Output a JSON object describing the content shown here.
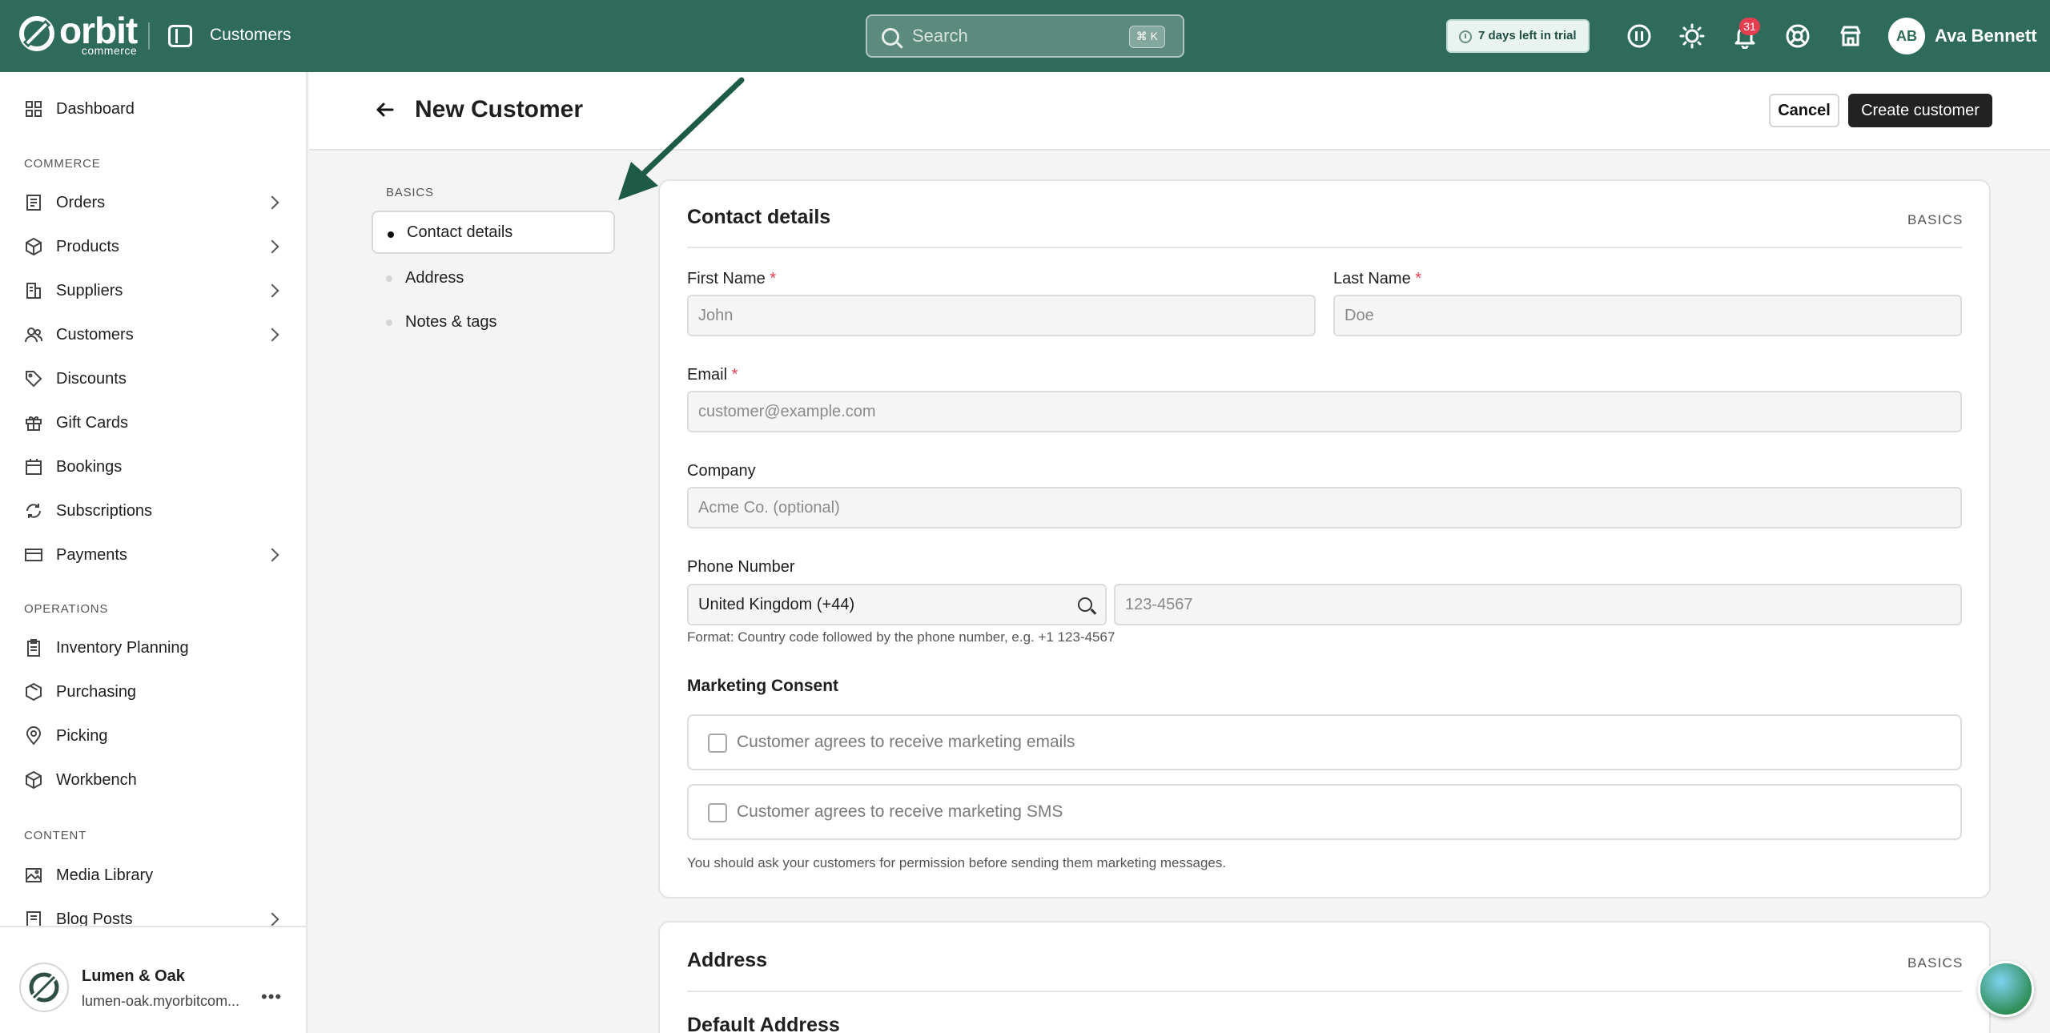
{
  "app": {
    "brand": "orbit",
    "brand_sub": "commerce",
    "header_title": "Customers",
    "accent_color": "#2f6b5a"
  },
  "search": {
    "placeholder": "Search",
    "shortcut": "⌘ K"
  },
  "trial": {
    "text": "7 days left in trial"
  },
  "notifications": {
    "count": "31"
  },
  "user": {
    "initials": "AB",
    "name": "Ava Bennett"
  },
  "sidebar": {
    "items": [
      {
        "label": "Dashboard",
        "icon": "dashboard-icon",
        "chevron": false
      },
      {
        "label": "Orders",
        "icon": "orders-icon",
        "chevron": true
      },
      {
        "label": "Products",
        "icon": "products-icon",
        "chevron": true
      },
      {
        "label": "Suppliers",
        "icon": "suppliers-icon",
        "chevron": true
      },
      {
        "label": "Customers",
        "icon": "customers-icon",
        "chevron": true
      },
      {
        "label": "Discounts",
        "icon": "tag-icon",
        "chevron": false
      },
      {
        "label": "Gift Cards",
        "icon": "gift-icon",
        "chevron": false
      },
      {
        "label": "Bookings",
        "icon": "calendar-icon",
        "chevron": false
      },
      {
        "label": "Subscriptions",
        "icon": "refresh-icon",
        "chevron": false
      },
      {
        "label": "Payments",
        "icon": "card-icon",
        "chevron": true
      },
      {
        "label": "Inventory Planning",
        "icon": "clipboard-icon",
        "chevron": false
      },
      {
        "label": "Purchasing",
        "icon": "box-icon",
        "chevron": false
      },
      {
        "label": "Picking",
        "icon": "pin-icon",
        "chevron": false
      },
      {
        "label": "Workbench",
        "icon": "cube-icon",
        "chevron": false
      },
      {
        "label": "Media Library",
        "icon": "image-icon",
        "chevron": false
      },
      {
        "label": "Blog Posts",
        "icon": "document-icon",
        "chevron": true
      }
    ],
    "sections": {
      "commerce": "COMMERCE",
      "operations": "OPERATIONS",
      "content": "CONTENT"
    }
  },
  "store": {
    "name": "Lumen & Oak",
    "url": "lumen-oak.myorbitcom..."
  },
  "page": {
    "title": "New Customer",
    "cancel_label": "Cancel",
    "create_label": "Create customer"
  },
  "section_nav": {
    "title": "BASICS",
    "items": [
      "Contact details",
      "Address",
      "Notes & tags"
    ],
    "active": "Contact details"
  },
  "contact_card": {
    "title": "Contact details",
    "tag": "BASICS",
    "first_name": {
      "label": "First Name",
      "required": "*",
      "placeholder": "John"
    },
    "last_name": {
      "label": "Last Name",
      "required": "*",
      "placeholder": "Doe"
    },
    "email": {
      "label": "Email",
      "required": "*",
      "placeholder": "customer@example.com"
    },
    "company": {
      "label": "Company",
      "placeholder": "Acme Co. (optional)"
    },
    "phone": {
      "label": "Phone Number",
      "country": "United Kingdom (+44)",
      "placeholder": "123-4567",
      "hint": "Format: Country code followed by the phone number, e.g. +1 123-4567"
    },
    "marketing": {
      "title": "Marketing Consent",
      "emails": "Customer agrees to receive marketing emails",
      "sms": "Customer agrees to receive marketing SMS",
      "note": "You should ask your customers for permission before sending them marketing messages."
    }
  },
  "address_card": {
    "title": "Address",
    "tag": "BASICS",
    "subtitle": "Default Address"
  }
}
